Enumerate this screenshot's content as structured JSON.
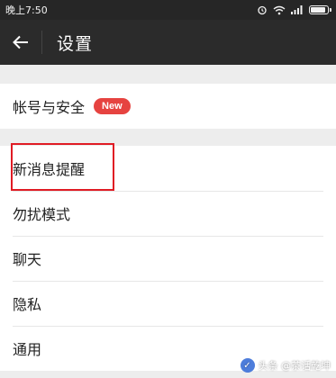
{
  "status_bar": {
    "time": "晚上7:50",
    "battery_level": 0.9
  },
  "header": {
    "title": "设置"
  },
  "section1": {
    "items": [
      {
        "label": "帐号与安全",
        "badge": "New"
      }
    ]
  },
  "section2": {
    "items": [
      {
        "label": "新消息提醒"
      },
      {
        "label": "勿扰模式"
      },
      {
        "label": "聊天"
      },
      {
        "label": "隐私"
      },
      {
        "label": "通用"
      }
    ]
  },
  "watermark": {
    "text": "头条 @茶话乾坤"
  },
  "colors": {
    "status_bar": "#262626",
    "action_bar": "#2b2b2b",
    "badge": "#e64340",
    "highlight": "#e01b24",
    "background": "#ededed"
  }
}
